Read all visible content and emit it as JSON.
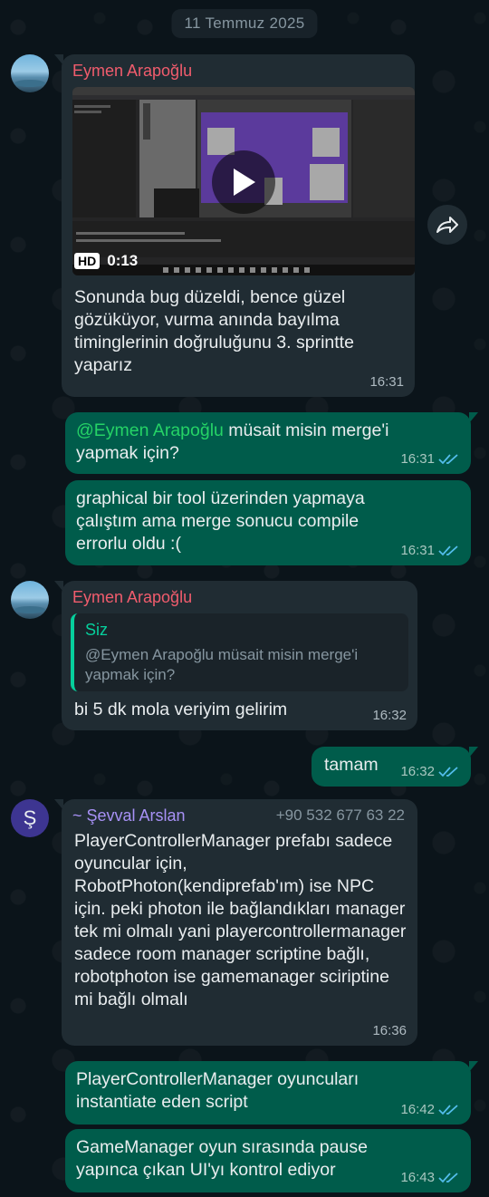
{
  "date_chip": "11 Temmuz 2025",
  "colors": {
    "incoming_bubble": "#202c33",
    "outgoing_bubble": "#005c4b",
    "sender_red": "#f15c6d",
    "sender_purple": "#a791f5",
    "read_ticks": "#53bdeb"
  },
  "messages": [
    {
      "sender": "Eymen Arapoğlu",
      "video": {
        "hd_badge": "HD",
        "duration": "0:13"
      },
      "text": "Sonunda bug düzeldi, bence güzel gözüküyor, vurma anında bayılma timinglerinin doğruluğunu 3. sprintte yaparız",
      "time": "16:31"
    },
    {
      "mention": "@Eymen Arapoğlu",
      "text": " müsait misin merge'i yapmak için?",
      "time": "16:31",
      "status": "read"
    },
    {
      "text": "graphical bir tool üzerinden yapmaya çalıştım ama merge sonucu compile errorlu oldu :(",
      "time": "16:31",
      "status": "read"
    },
    {
      "sender": "Eymen Arapoğlu",
      "quote": {
        "name": "Siz",
        "text": "@Eymen Arapoğlu müsait misin merge'i yapmak için?"
      },
      "text": "bi 5 dk mola veriyim gelirim",
      "time": "16:32"
    },
    {
      "text": "tamam",
      "time": "16:32",
      "status": "read"
    },
    {
      "avatar_letter": "Ş",
      "sender": "~ Şevval Arslan",
      "phone": "+90 532 677 63 22",
      "text": "PlayerControllerManager prefabı sadece oyuncular için, RobotPhoton(kendiprefab'ım) ise NPC için. peki photon ile bağlandıkları manager tek mi olmalı yani playercontrollermanager sadece room manager scriptine bağlı, robotphoton ise gamemanager sciriptine mi bağlı olmalı",
      "time": "16:36"
    },
    {
      "text": "PlayerControllerManager oyuncuları instantiate eden script",
      "time": "16:42",
      "status": "read"
    },
    {
      "text": "GameManager oyun sırasında pause yapınca çıkan UI'yı kontrol ediyor",
      "time": "16:43",
      "status": "read"
    }
  ]
}
